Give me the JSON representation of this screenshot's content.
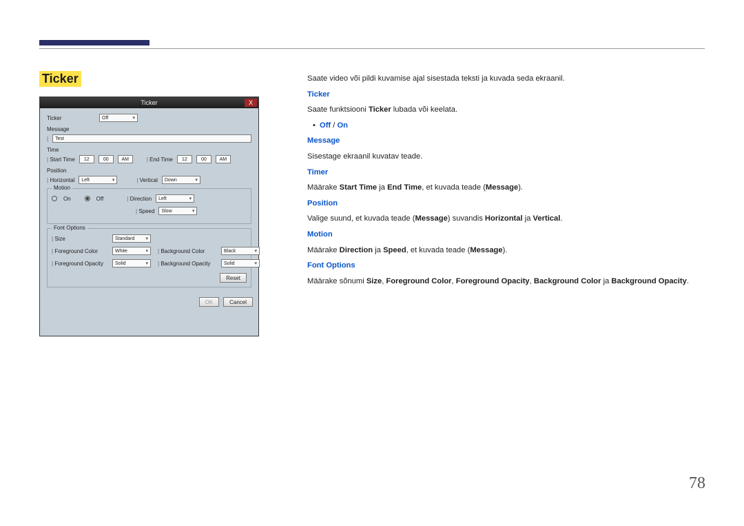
{
  "page_number": "78",
  "heading": "Ticker",
  "screenshot": {
    "title": "Ticker",
    "close": "X",
    "ticker_label": "Ticker",
    "ticker_value": "Off",
    "message_label": "Message",
    "message_value": "Test",
    "time_label": "Time",
    "start_time_label": "Start Time",
    "end_time_label": "End Time",
    "hh1": "12",
    "mm1": "00",
    "ap1": "AM",
    "hh2": "12",
    "mm2": "00",
    "ap2": "AM",
    "position_label": "Position",
    "horiz_label": "Horizontal",
    "horiz_value": "Left",
    "vert_label": "Vertical",
    "vert_value": "Down",
    "motion_legend": "Motion",
    "on_label": "On",
    "off_label": "Off",
    "direction_label": "Direction",
    "direction_value": "Left",
    "speed_label": "Speed",
    "speed_value": "Slow",
    "font_legend": "Font Options",
    "size_label": "Size",
    "size_value": "Standard",
    "fg_color_label": "Foreground Color",
    "fg_color_value": "White",
    "fg_op_label": "Foreground Opacity",
    "fg_op_value": "Solid",
    "bg_color_label": "Background Color",
    "bg_color_value": "Black",
    "bg_op_label": "Background Opacity",
    "bg_op_value": "Solid",
    "reset_btn": "Reset",
    "ok_btn": "OK",
    "cancel_btn": "Cancel"
  },
  "body": {
    "p1": "Saate video või pildi kuvamise ajal sisestada teksti ja kuvada seda ekraanil.",
    "h1": "Ticker",
    "p2a": "Saate funktsiooni ",
    "p2b": "Ticker",
    "p2c": " lubada või keelata.",
    "opt_off": "Off",
    "opt_sep": " / ",
    "opt_on": "On",
    "h2": "Message",
    "p3": "Sisestage ekraanil kuvatav teade.",
    "h3": "Timer",
    "p4a": "Määrake ",
    "p4b": "Start Time",
    "p4c": " ja ",
    "p4d": "End Time",
    "p4e": ", et kuvada teade (",
    "p4f": "Message",
    "p4g": ").",
    "h4": "Position",
    "p5a": "Valige suund, et kuvada teade (",
    "p5b": "Message",
    "p5c": ") suvandis ",
    "p5d": "Horizontal",
    "p5e": " ja ",
    "p5f": "Vertical",
    "p5g": ".",
    "h5": "Motion",
    "p6a": "Määrake ",
    "p6b": "Direction",
    "p6c": " ja ",
    "p6d": "Speed",
    "p6e": ", et kuvada teade (",
    "p6f": "Message",
    "p6g": ").",
    "h6": "Font Options",
    "p7a": "Määrake sõnumi ",
    "p7b": "Size",
    "p7c": ", ",
    "p7d": "Foreground Color",
    "p7e": ", ",
    "p7f": "Foreground Opacity",
    "p7g": ", ",
    "p7h": "Background Color",
    "p7i": " ja ",
    "p7j": "Background Opacity",
    "p7k": "."
  }
}
